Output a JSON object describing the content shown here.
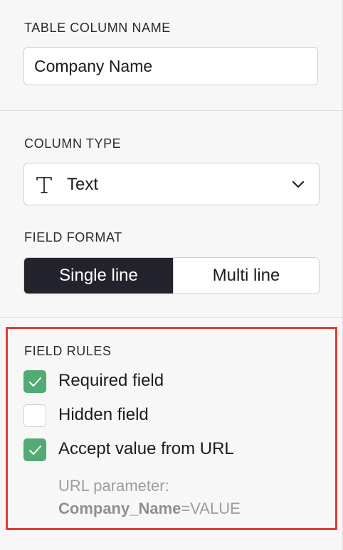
{
  "column_name": {
    "label": "TABLE COLUMN NAME",
    "value": "Company Name"
  },
  "column_type": {
    "label": "COLUMN TYPE",
    "selected": "Text",
    "icon": "text-type-icon"
  },
  "field_format": {
    "label": "FIELD FORMAT",
    "options": [
      "Single line",
      "Multi line"
    ],
    "selected": "Single line"
  },
  "field_rules": {
    "label": "FIELD RULES",
    "rules": [
      {
        "label": "Required field",
        "checked": true
      },
      {
        "label": "Hidden field",
        "checked": false
      },
      {
        "label": "Accept value from URL",
        "checked": true
      }
    ],
    "url_parameter": {
      "label": "URL parameter:",
      "name": "Company_Name",
      "suffix": "=VALUE"
    }
  },
  "colors": {
    "checkbox_checked": "#52ab74",
    "segment_active": "#23232d",
    "highlight_border": "#e04032"
  }
}
